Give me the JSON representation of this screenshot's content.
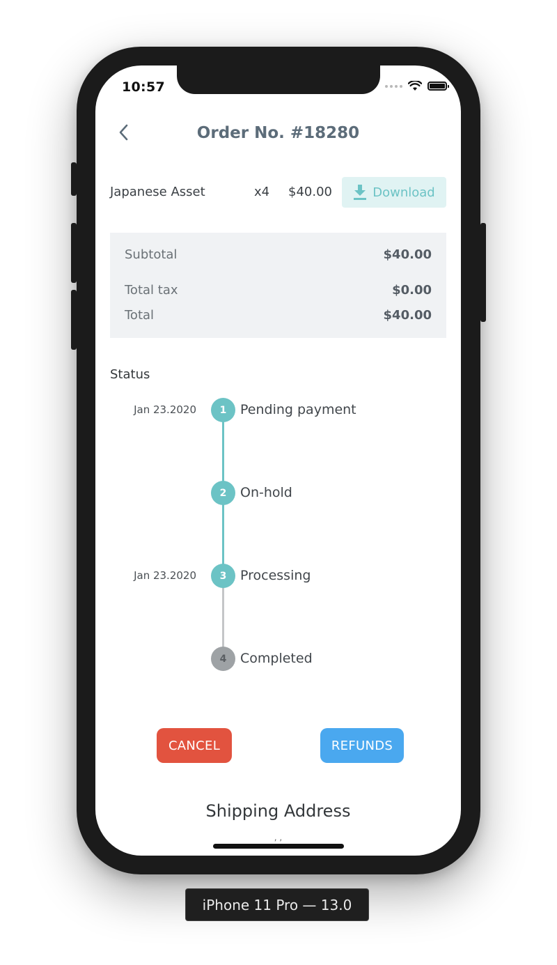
{
  "status_bar": {
    "time": "10:57"
  },
  "header": {
    "title": "Order No. #18280"
  },
  "order_item": {
    "name": "Japanese Asset",
    "quantity": "x4",
    "price": "$40.00",
    "download_label": "Download"
  },
  "summary": {
    "rows": [
      {
        "label": "Subtotal",
        "value": "$40.00"
      },
      {
        "label": "Total tax",
        "value": "$0.00"
      },
      {
        "label": "Total",
        "value": "$40.00"
      }
    ]
  },
  "status": {
    "heading": "Status",
    "steps": [
      {
        "number": "1",
        "label": "Pending payment",
        "date": "Jan 23.2020",
        "state": "done"
      },
      {
        "number": "2",
        "label": "On-hold",
        "date": "",
        "state": "done"
      },
      {
        "number": "3",
        "label": "Processing",
        "date": "Jan 23.2020",
        "state": "done"
      },
      {
        "number": "4",
        "label": "Completed",
        "date": "",
        "state": "pending"
      }
    ]
  },
  "actions": {
    "cancel_label": "CANCEL",
    "refunds_label": "REFUNDS"
  },
  "shipping": {
    "title": "Shipping Address",
    "address": ", ,"
  },
  "device_label": "iPhone 11 Pro — 13.0",
  "colors": {
    "accent": "#6cc3c5",
    "timeline_done": "#6cc3c5",
    "timeline_pending": "#9ea2a5",
    "cancel": "#e2533f",
    "refunds": "#4aa8ef",
    "title": "#5c6c79"
  }
}
